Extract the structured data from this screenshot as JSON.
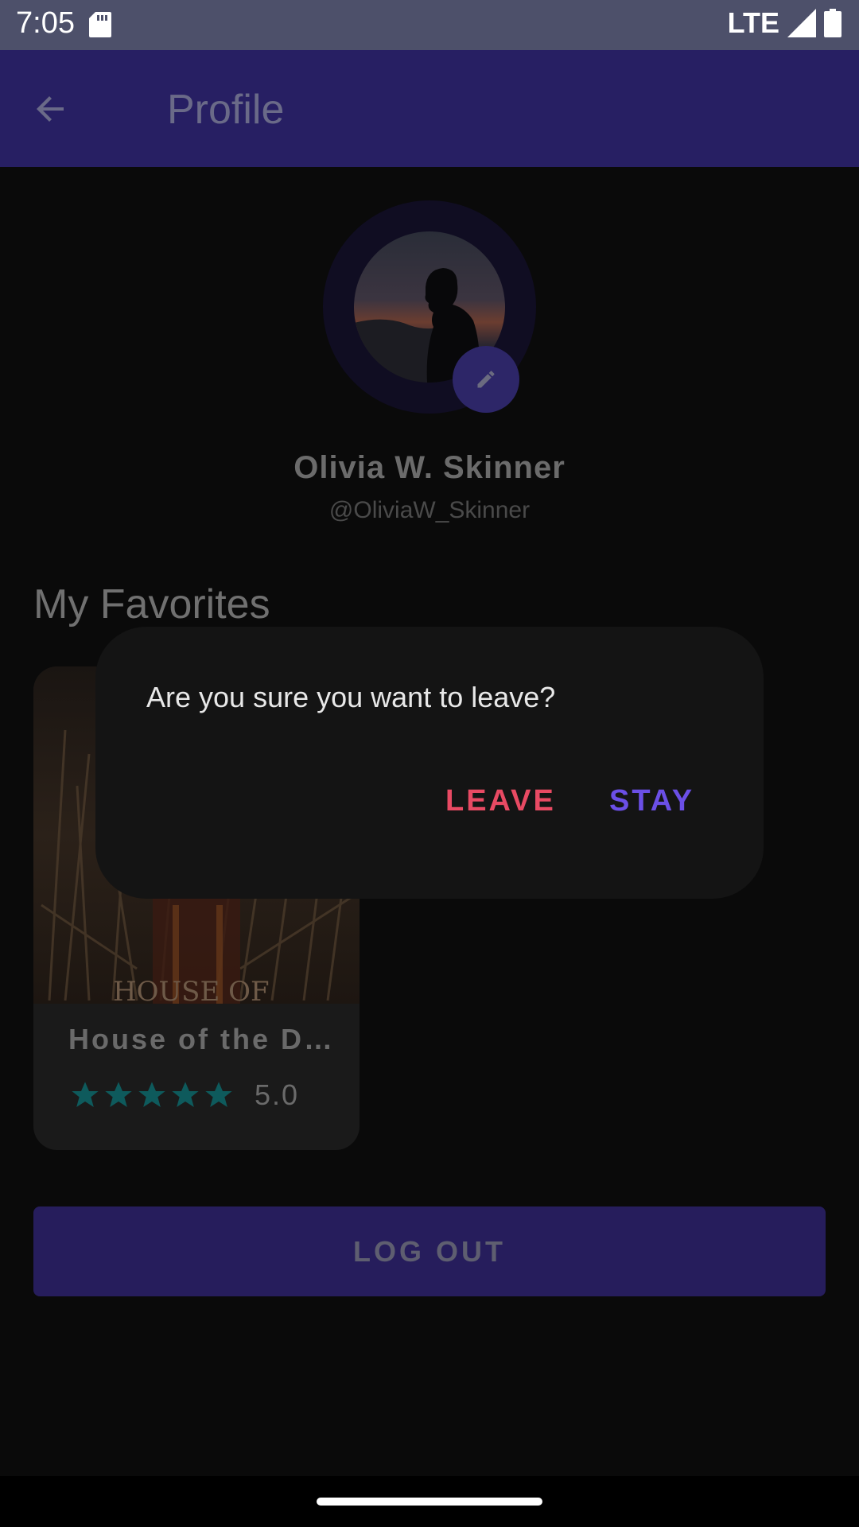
{
  "status_bar": {
    "time": "7:05",
    "network": "LTE"
  },
  "app_bar": {
    "title": "Profile",
    "back_icon": "arrow-back-icon"
  },
  "profile": {
    "name": "Olivia W. Skinner",
    "handle": "@OliviaW_Skinner",
    "edit_icon": "pencil-icon"
  },
  "favorites": {
    "section_title": "My Favorites",
    "items": [
      {
        "poster_text": "HOUSE OF",
        "title": "House of the D…",
        "rating_value": "5.0",
        "stars": 5,
        "star_color": "#0e5a5c"
      }
    ]
  },
  "logout": {
    "label": "LOG OUT"
  },
  "dialog": {
    "message": "Are you sure you want to leave?",
    "leave_label": "LEAVE",
    "stay_label": "STAY",
    "leave_color": "#e84a63",
    "stay_color": "#6b4fe6"
  },
  "colors": {
    "app_bar": "#271f63",
    "status_bar": "#4d506a",
    "background": "#0a0a0a",
    "dialog": "#141414"
  }
}
